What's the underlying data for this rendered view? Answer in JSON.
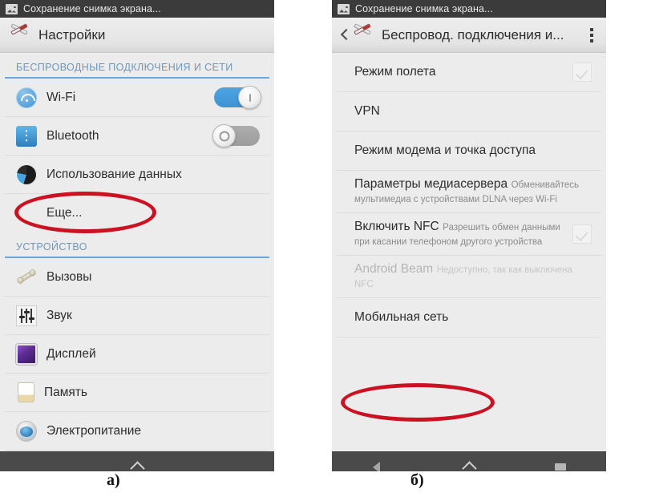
{
  "figure": {
    "caption_a": "а)",
    "caption_b": "б)"
  },
  "left_phone": {
    "status_bar": {
      "icon": "screenshot-image-icon",
      "text": "Сохранение снимка экрана..."
    },
    "action_bar": {
      "icon": "settings-tools-icon",
      "title": "Настройки"
    },
    "sections": [
      {
        "header": "БЕСПРОВОДНЫЕ ПОДКЛЮЧЕНИЯ И СЕТИ",
        "rows": [
          {
            "icon": "wifi-icon",
            "label": "Wi-Fi",
            "control": "toggle",
            "state": "on"
          },
          {
            "icon": "bluetooth-icon",
            "label": "Bluetooth",
            "control": "toggle",
            "state": "off"
          },
          {
            "icon": "data-usage-icon",
            "label": "Использование данных",
            "control": "none"
          },
          {
            "icon": "none",
            "label": "Еще...",
            "control": "none",
            "highlighted": true
          }
        ]
      },
      {
        "header": "УСТРОЙСТВО",
        "rows": [
          {
            "icon": "calls-icon",
            "label": "Вызовы",
            "control": "none"
          },
          {
            "icon": "sound-icon",
            "label": "Звук",
            "control": "none"
          },
          {
            "icon": "display-icon",
            "label": "Дисплей",
            "control": "none"
          },
          {
            "icon": "storage-icon",
            "label": "Память",
            "control": "none"
          },
          {
            "icon": "power-icon",
            "label": "Электропитание",
            "control": "none"
          }
        ]
      }
    ],
    "nav_bar": {
      "buttons": [
        "home-button"
      ]
    }
  },
  "right_phone": {
    "status_bar": {
      "icon": "screenshot-image-icon",
      "text": "Сохранение снимка экрана..."
    },
    "action_bar": {
      "back_icon": "back-chevron-icon",
      "icon": "settings-tools-icon",
      "title": "Беспровод. подключения и...",
      "overflow_icon": "overflow-menu-icon"
    },
    "rows": [
      {
        "label": "Режим полета",
        "sublabel": "",
        "control": "checkbox",
        "state": "unchecked",
        "disabled": false
      },
      {
        "label": "VPN",
        "sublabel": "",
        "control": "none",
        "disabled": false
      },
      {
        "label": "Режим модема и точка доступа",
        "sublabel": "",
        "control": "none",
        "disabled": false
      },
      {
        "label": "Параметры медиасервера",
        "sublabel": "Обменивайтесь мультимедиа с устройствами DLNA через Wi-Fi",
        "control": "none",
        "disabled": false
      },
      {
        "label": "Включить NFC",
        "sublabel": "Разрешить обмен данными при касании телефоном другого устройства",
        "control": "checkbox",
        "state": "unchecked",
        "disabled": false
      },
      {
        "label": "Android Beam",
        "sublabel": "Недоступно, так как выключена NFC",
        "control": "none",
        "disabled": true
      },
      {
        "label": "Мобильная сеть",
        "sublabel": "",
        "control": "none",
        "disabled": false,
        "highlighted": true
      }
    ],
    "nav_bar": {
      "buttons": [
        "back-button",
        "home-button",
        "recents-button"
      ]
    }
  },
  "annotations": {
    "ellipse_color": "#cc1122",
    "ellipse_targets": [
      "Еще...",
      "Мобильная сеть"
    ]
  }
}
